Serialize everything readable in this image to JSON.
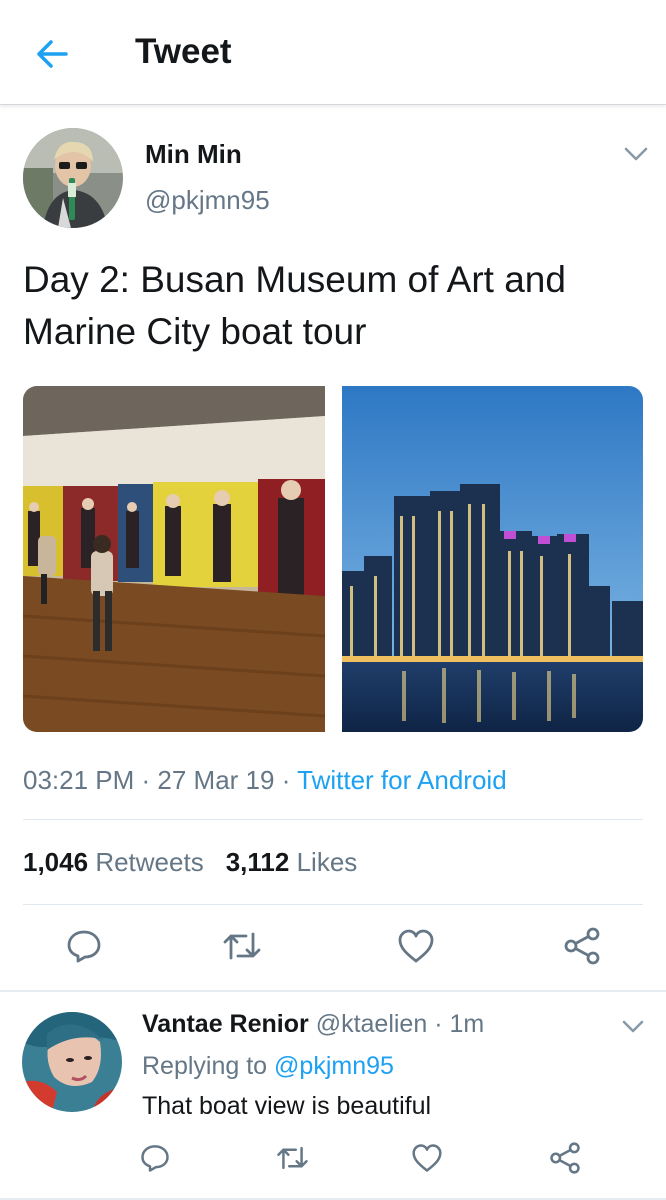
{
  "header": {
    "title": "Tweet",
    "back_icon": "arrow-left-icon",
    "accent": "#1da1f2"
  },
  "tweet": {
    "author_name": "Min Min",
    "author_handle": "@pkjmn95",
    "text": "Day 2: Busan Museum of Art and Marine City boat tour",
    "images": [
      "Busan Museum of Art gallery photo",
      "Marine City skyline photo"
    ],
    "time": "03:21 PM",
    "date": "27 Mar 19",
    "source": "Twitter for Android",
    "retweets_count": "1,046",
    "retweets_label": "Retweets",
    "likes_count": "3,112",
    "likes_label": "Likes",
    "actions": [
      "reply-icon",
      "retweet-icon",
      "like-icon",
      "share-icon"
    ]
  },
  "reply": {
    "author_name": "Vantae Renior",
    "author_handle": "@ktaelien",
    "age": "1m",
    "replying_prefix": "Replying to",
    "replying_to": "@pkjmn95",
    "text": "That boat view is beautiful"
  },
  "colors": {
    "text": "#14171a",
    "secondary": "#657786",
    "link": "#1da1f2",
    "divider": "#e1e8ed"
  }
}
